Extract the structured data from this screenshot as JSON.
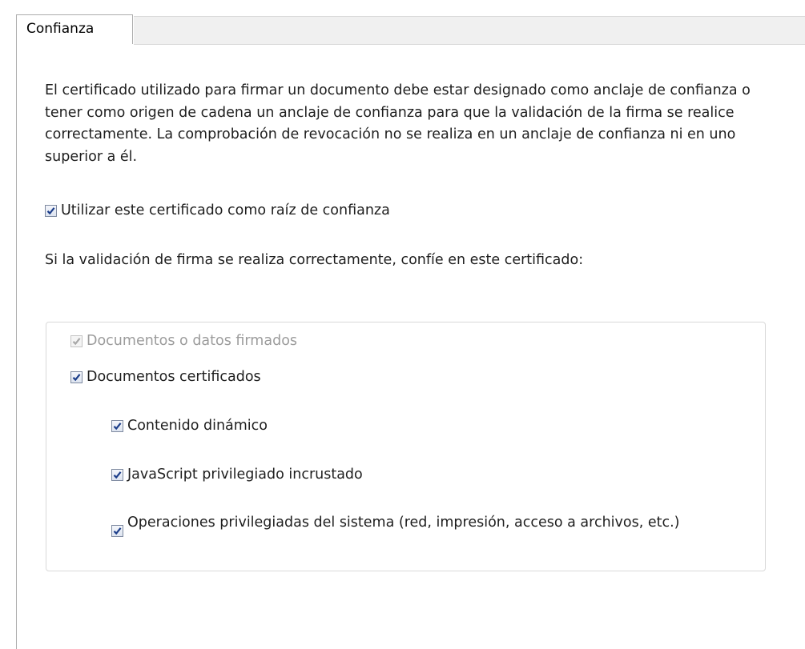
{
  "tab": {
    "label": "Confianza"
  },
  "description": "El certificado utilizado para firmar un documento debe estar designado como anclaje de confianza o tener como origen de cadena un anclaje de confianza para que la validación de la firma se realice correctamente. La comprobación de revocación no se realiza en un anclaje de confianza ni en uno superior a él.",
  "root_trust": {
    "label": "Utilizar este certificado como raíz de confianza",
    "checked": true
  },
  "trust_question": "Si la validación de firma se realiza correctamente, confíe en este certificado:",
  "options": {
    "signed_docs": {
      "label": "Documentos o datos firmados",
      "checked": true,
      "enabled": false
    },
    "certified_docs": {
      "label": "Documentos certificados",
      "checked": true,
      "enabled": true
    },
    "dynamic_content": {
      "label": "Contenido dinámico",
      "checked": true,
      "enabled": true
    },
    "privileged_js": {
      "label": "JavaScript privilegiado incrustado",
      "checked": true,
      "enabled": true
    },
    "privileged_ops": {
      "label": "Operaciones privilegiadas del sistema (red, impresión, acceso a archivos, etc.)",
      "checked": true,
      "enabled": true
    }
  },
  "colors": {
    "checkmark": "#1c3e8a",
    "checkmark_disabled": "#a8a8a8",
    "text": "#1e1e1e",
    "text_disabled": "#9c9c9c",
    "group_border": "#d9d9d9",
    "tab_bar_bg": "#f0f0f0"
  }
}
